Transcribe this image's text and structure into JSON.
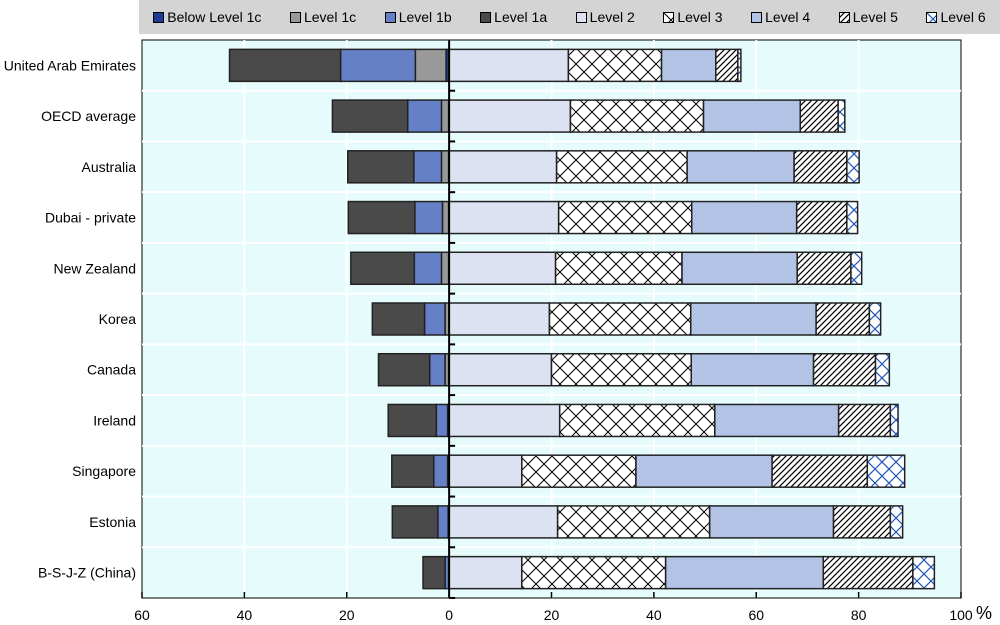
{
  "chart_data": {
    "type": "bar",
    "orientation": "horizontal-stacked-diverging",
    "title": "",
    "xlabel": "%",
    "xlim": [
      -60,
      100
    ],
    "xticks": [
      "60",
      "40",
      "20",
      "0",
      "20",
      "40",
      "60",
      "80",
      "100"
    ],
    "xtick_values": [
      -60,
      -40,
      -20,
      0,
      20,
      40,
      60,
      80,
      100
    ],
    "unit_label": "%",
    "legend_position": "top",
    "categories": [
      "United Arab Emirates",
      "OECD average",
      "Australia",
      "Dubai - private",
      "New Zealand",
      "Korea",
      "Canada",
      "Ireland",
      "Singapore",
      "Estonia",
      "B-S-J-Z (China)"
    ],
    "series": [
      {
        "name": "Below Level 1c",
        "side": "left",
        "color": "#1f3a93",
        "pattern": "solid",
        "values": [
          0.6,
          0.1,
          0.1,
          0.1,
          0.1,
          0.0,
          0.1,
          0.0,
          0.0,
          0.0,
          0.0
        ]
      },
      {
        "name": "Level 1c",
        "side": "left",
        "color": "#999999",
        "pattern": "solid",
        "values": [
          6.0,
          1.4,
          1.4,
          1.2,
          1.4,
          0.8,
          0.7,
          0.3,
          0.3,
          0.2,
          0.1
        ]
      },
      {
        "name": "Level 1b",
        "side": "left",
        "color": "#6680c8",
        "pattern": "solid",
        "values": [
          14.6,
          6.6,
          5.4,
          5.4,
          5.3,
          4.0,
          3.0,
          2.2,
          2.7,
          2.0,
          0.7
        ]
      },
      {
        "name": "Level 1a",
        "side": "left",
        "color": "#4a4a4a",
        "pattern": "solid",
        "values": [
          21.7,
          14.7,
          12.9,
          13.0,
          12.4,
          10.2,
          10.0,
          9.4,
          8.2,
          8.9,
          4.3
        ]
      },
      {
        "name": "Level 2",
        "side": "right",
        "color": "#dde2f2",
        "pattern": "solid",
        "values": [
          23.3,
          23.7,
          21.0,
          21.4,
          20.8,
          19.6,
          20.0,
          21.6,
          14.2,
          21.2,
          14.2
        ]
      },
      {
        "name": "Level 3",
        "side": "right",
        "color": "#ffffff",
        "pattern": "crosshatch",
        "values": [
          18.2,
          26.0,
          25.5,
          26.0,
          24.7,
          27.6,
          27.3,
          30.3,
          22.3,
          29.7,
          28.1
        ]
      },
      {
        "name": "Level 4",
        "side": "right",
        "color": "#b3c3e6",
        "pattern": "solid",
        "values": [
          10.6,
          18.9,
          20.9,
          20.5,
          22.5,
          24.5,
          23.9,
          24.2,
          26.6,
          24.2,
          30.8
        ]
      },
      {
        "name": "Level 5",
        "side": "right",
        "color": "#ffffff",
        "pattern": "diagonal",
        "values": [
          4.3,
          7.4,
          10.3,
          9.8,
          10.5,
          10.4,
          12.1,
          10.1,
          18.6,
          11.1,
          17.5
        ]
      },
      {
        "name": "Level 6",
        "side": "right",
        "color": "#ffffff",
        "pattern": "blue-crosshatch",
        "values": [
          0.6,
          1.3,
          2.4,
          2.1,
          2.1,
          2.2,
          2.7,
          1.5,
          7.3,
          2.4,
          4.2
        ]
      }
    ]
  }
}
